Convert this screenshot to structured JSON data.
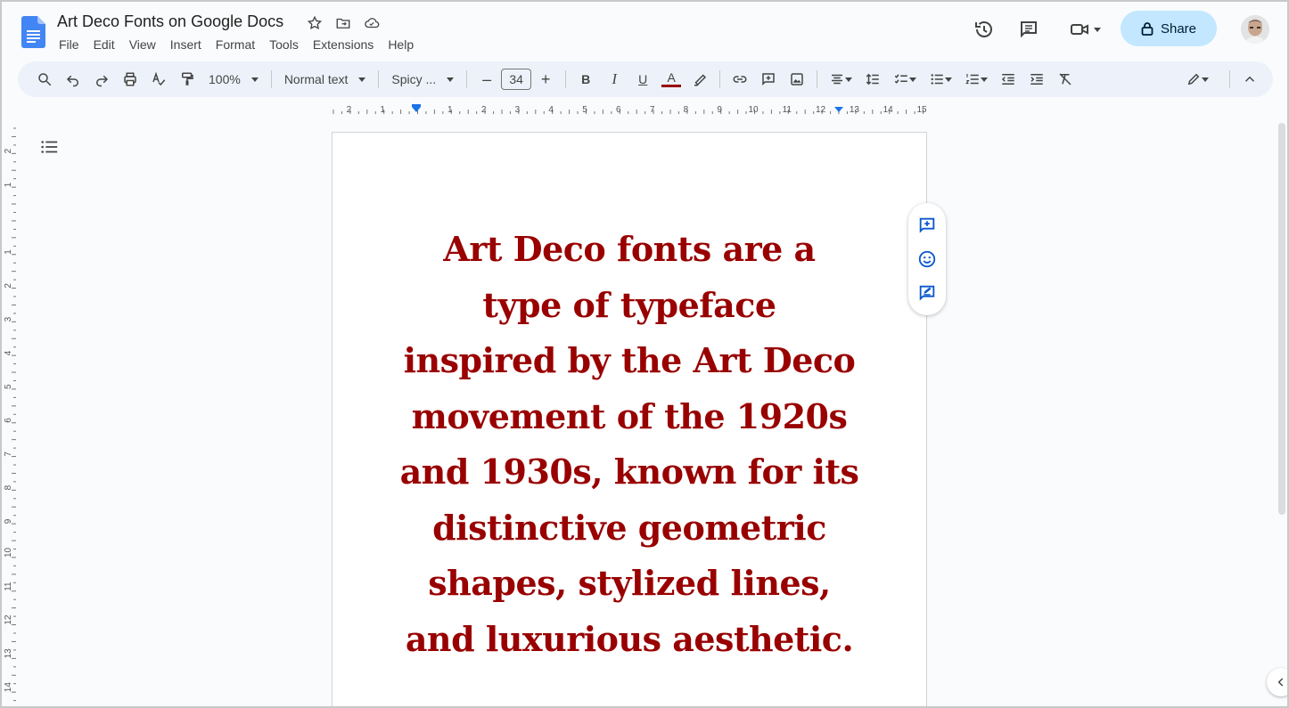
{
  "header": {
    "title": "Art Deco Fonts on Google Docs",
    "menu": [
      "File",
      "Edit",
      "View",
      "Insert",
      "Format",
      "Tools",
      "Extensions",
      "Help"
    ],
    "share_label": "Share",
    "icons": [
      "star-icon",
      "move-folder-icon",
      "cloud-saved-icon",
      "version-history-icon",
      "comments-icon",
      "meet-icon"
    ]
  },
  "toolbar": {
    "zoom": "100%",
    "style": "Normal text",
    "font": "Spicy ...",
    "font_size": "34",
    "bold": "B",
    "italic": "I",
    "underline": "U",
    "text_color_glyph": "A",
    "text_color": "#990000",
    "minus": "–",
    "plus": "+"
  },
  "ruler": {
    "horizontal": [
      "2",
      "1",
      "1",
      "2",
      "3",
      "4",
      "5",
      "6",
      "7",
      "8",
      "9",
      "10",
      "11",
      "12",
      "13",
      "14",
      "15"
    ],
    "vertical": [
      "2",
      "1",
      "1",
      "2",
      "3",
      "4",
      "5",
      "6",
      "7",
      "8",
      "9",
      "10",
      "11",
      "12",
      "13",
      "14"
    ]
  },
  "document": {
    "lines": [
      "Art Deco fonts are a",
      "type of typeface",
      "inspired by the Art Deco",
      "movement of the 1920s",
      "and 1930s, known for its",
      "distinctive geometric",
      "shapes, stylized lines,",
      "and luxurious aesthetic."
    ],
    "color": "#990000"
  },
  "colors": {
    "accent": "#0b57d0",
    "share_bg": "#c2e7ff",
    "toolbar_bg": "#edf2fa"
  }
}
